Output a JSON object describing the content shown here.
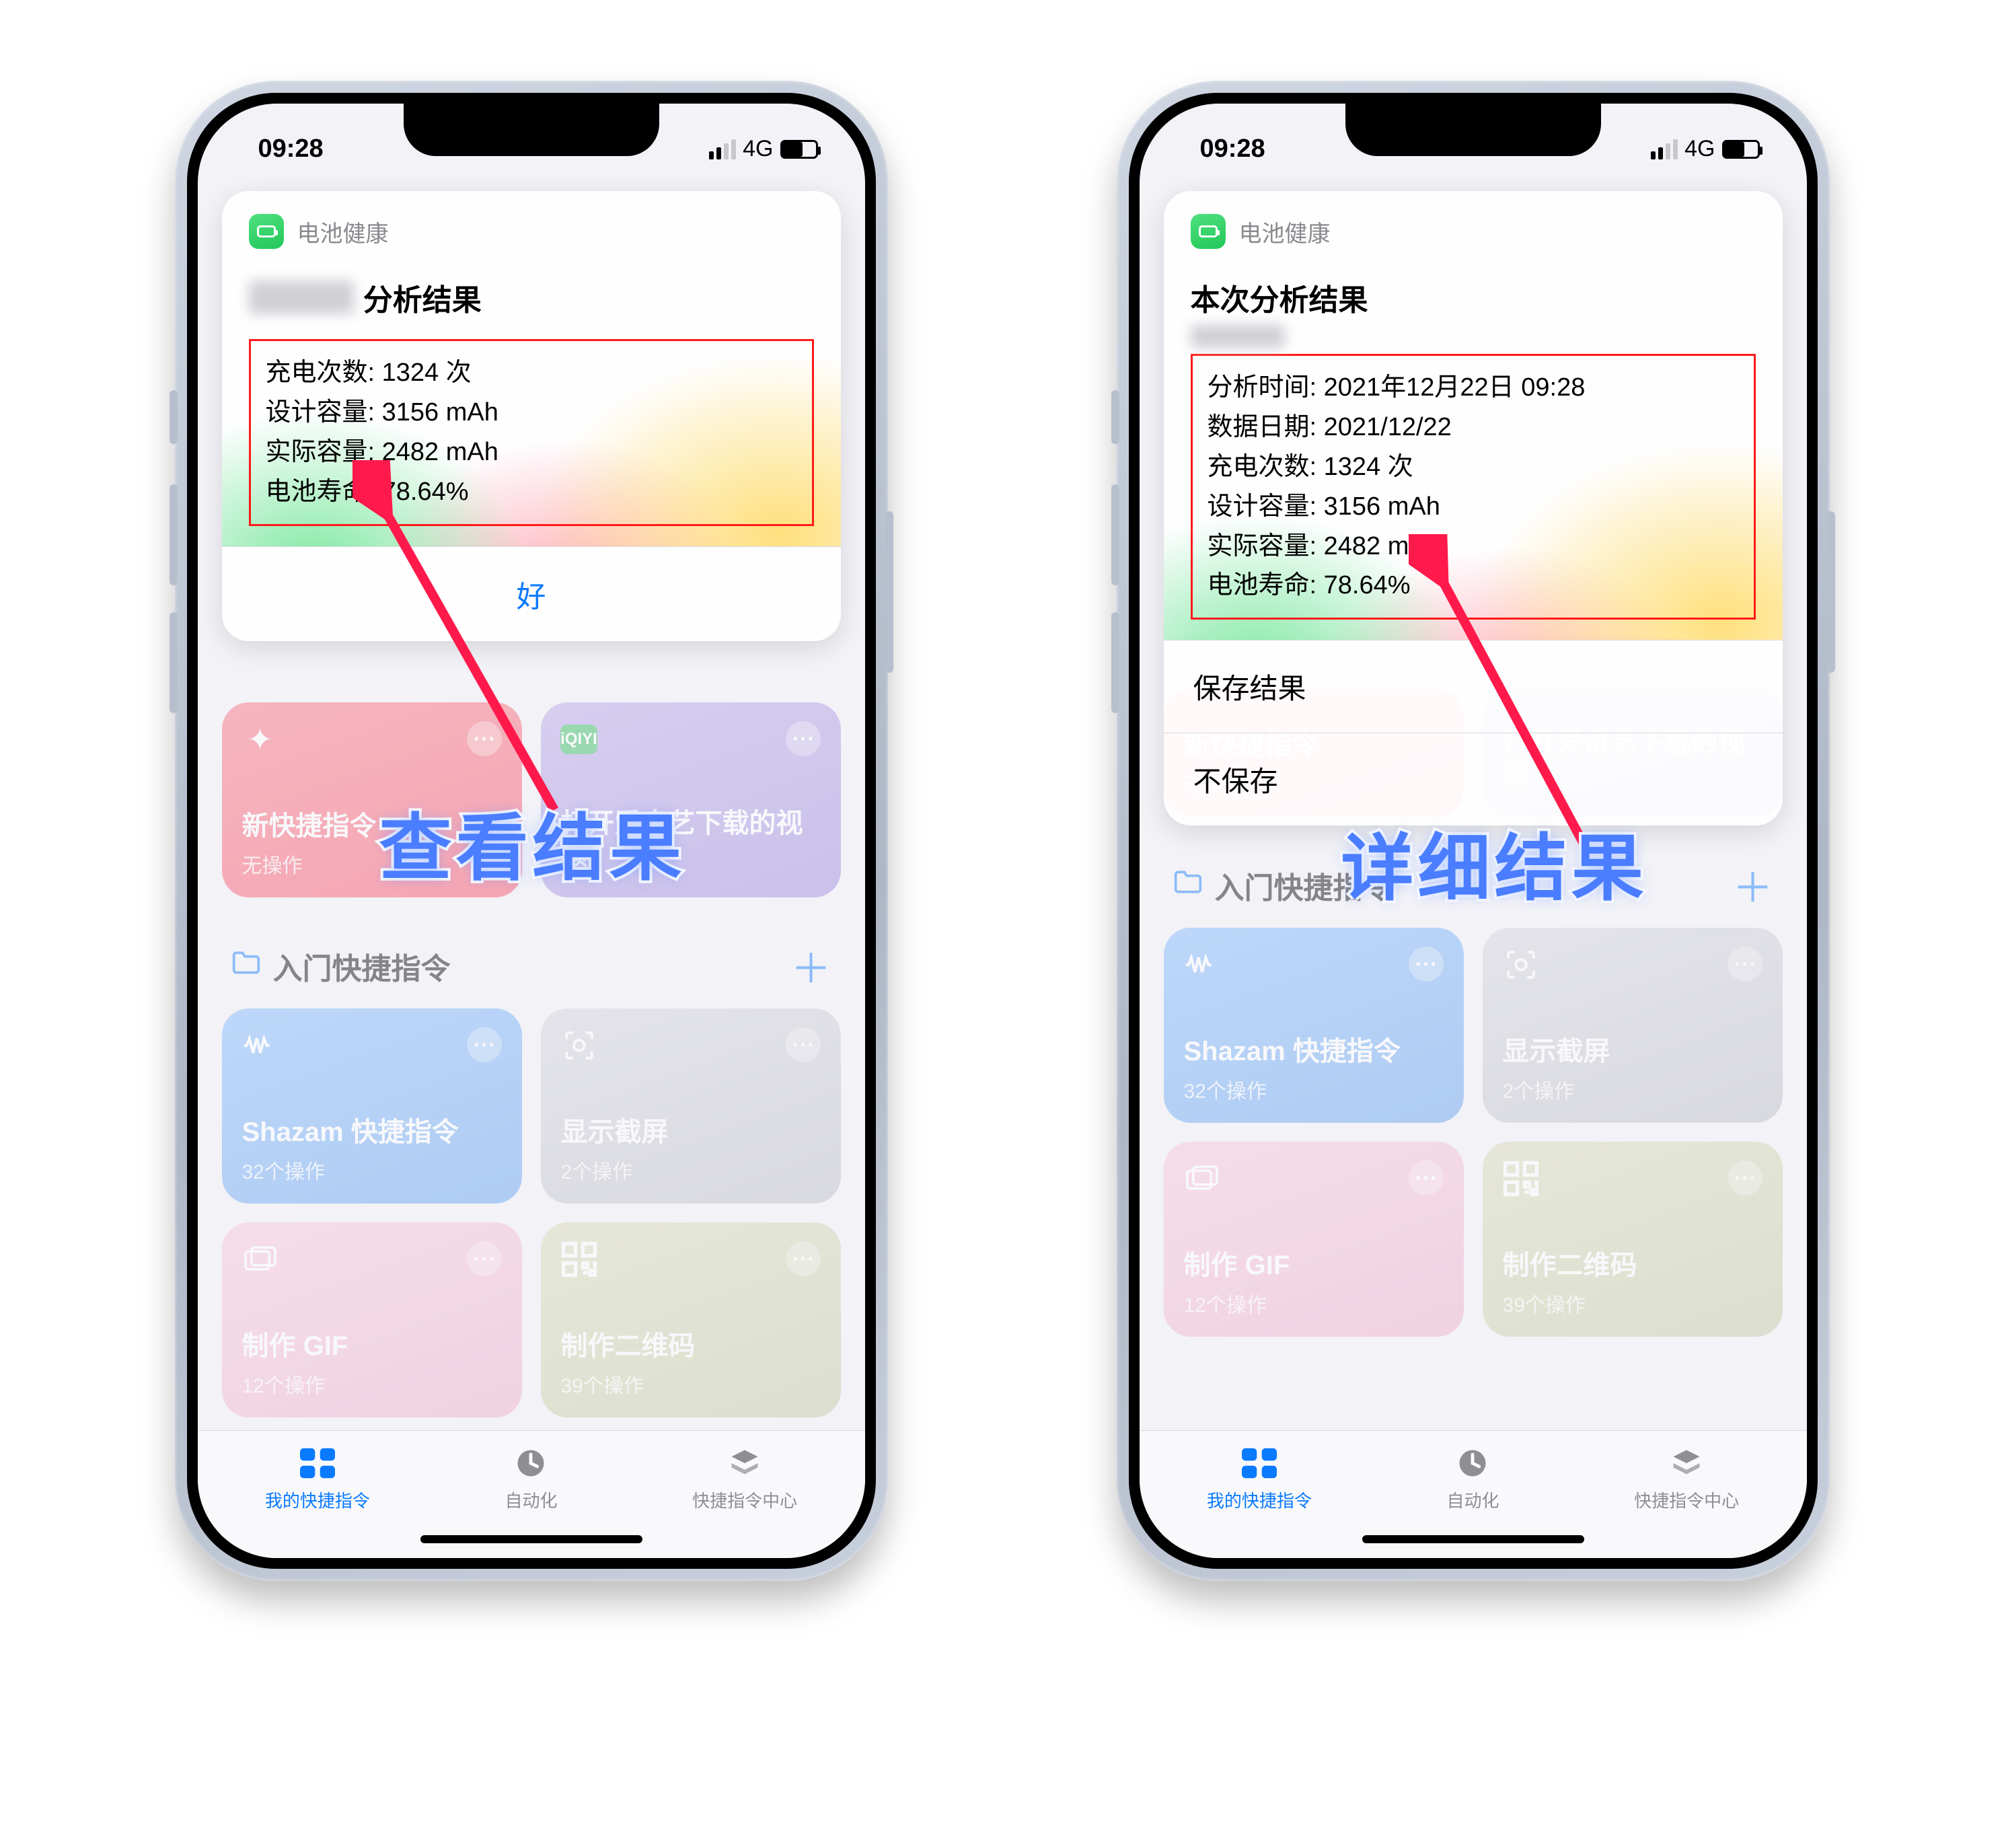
{
  "status": {
    "time": "09:28",
    "network": "4G"
  },
  "sheet_app_name": "电池健康",
  "left": {
    "title_prefix_hidden": "████",
    "title_suffix": "分析结果",
    "lines": {
      "charge_count": "充电次数: 1324 次",
      "design_cap": "设计容量: 3156 mAh",
      "actual_cap": "实际容量: 2482 mAh",
      "life": "电池寿命: 78.64%"
    },
    "ok_button": "好",
    "caption": "查看结果"
  },
  "right": {
    "title": "本次分析结果",
    "lines": {
      "analyzed_at": "分析时间: 2021年12月22日 09:28",
      "data_date": "数据日期: 2021/12/22",
      "charge_count": "充电次数: 1324 次",
      "design_cap": "设计容量: 3156 mAh",
      "actual_cap": "实际容量: 2482 mAh",
      "life": "电池寿命: 78.64%"
    },
    "save_button": "保存结果",
    "dismiss_button": "不保存",
    "caption": "详细结果"
  },
  "shortcuts_section": "入门快捷指令",
  "tiles": {
    "new_shortcut": {
      "title": "新快捷指令",
      "sub": "无操作"
    },
    "iqiyi": {
      "title": "打开爱奇艺下载的视频",
      "sub": "",
      "badge": "iQIYI"
    },
    "shazam": {
      "title": "Shazam 快捷指令",
      "sub": "32个操作"
    },
    "screenshot": {
      "title": "显示截屏",
      "sub": "2个操作"
    },
    "gif": {
      "title": "制作 GIF",
      "sub": "12个操作"
    },
    "qrcode": {
      "title": "制作二维码",
      "sub": "39个操作"
    }
  },
  "tabs": {
    "mine": "我的快捷指令",
    "automation": "自动化",
    "gallery": "快捷指令中心"
  }
}
